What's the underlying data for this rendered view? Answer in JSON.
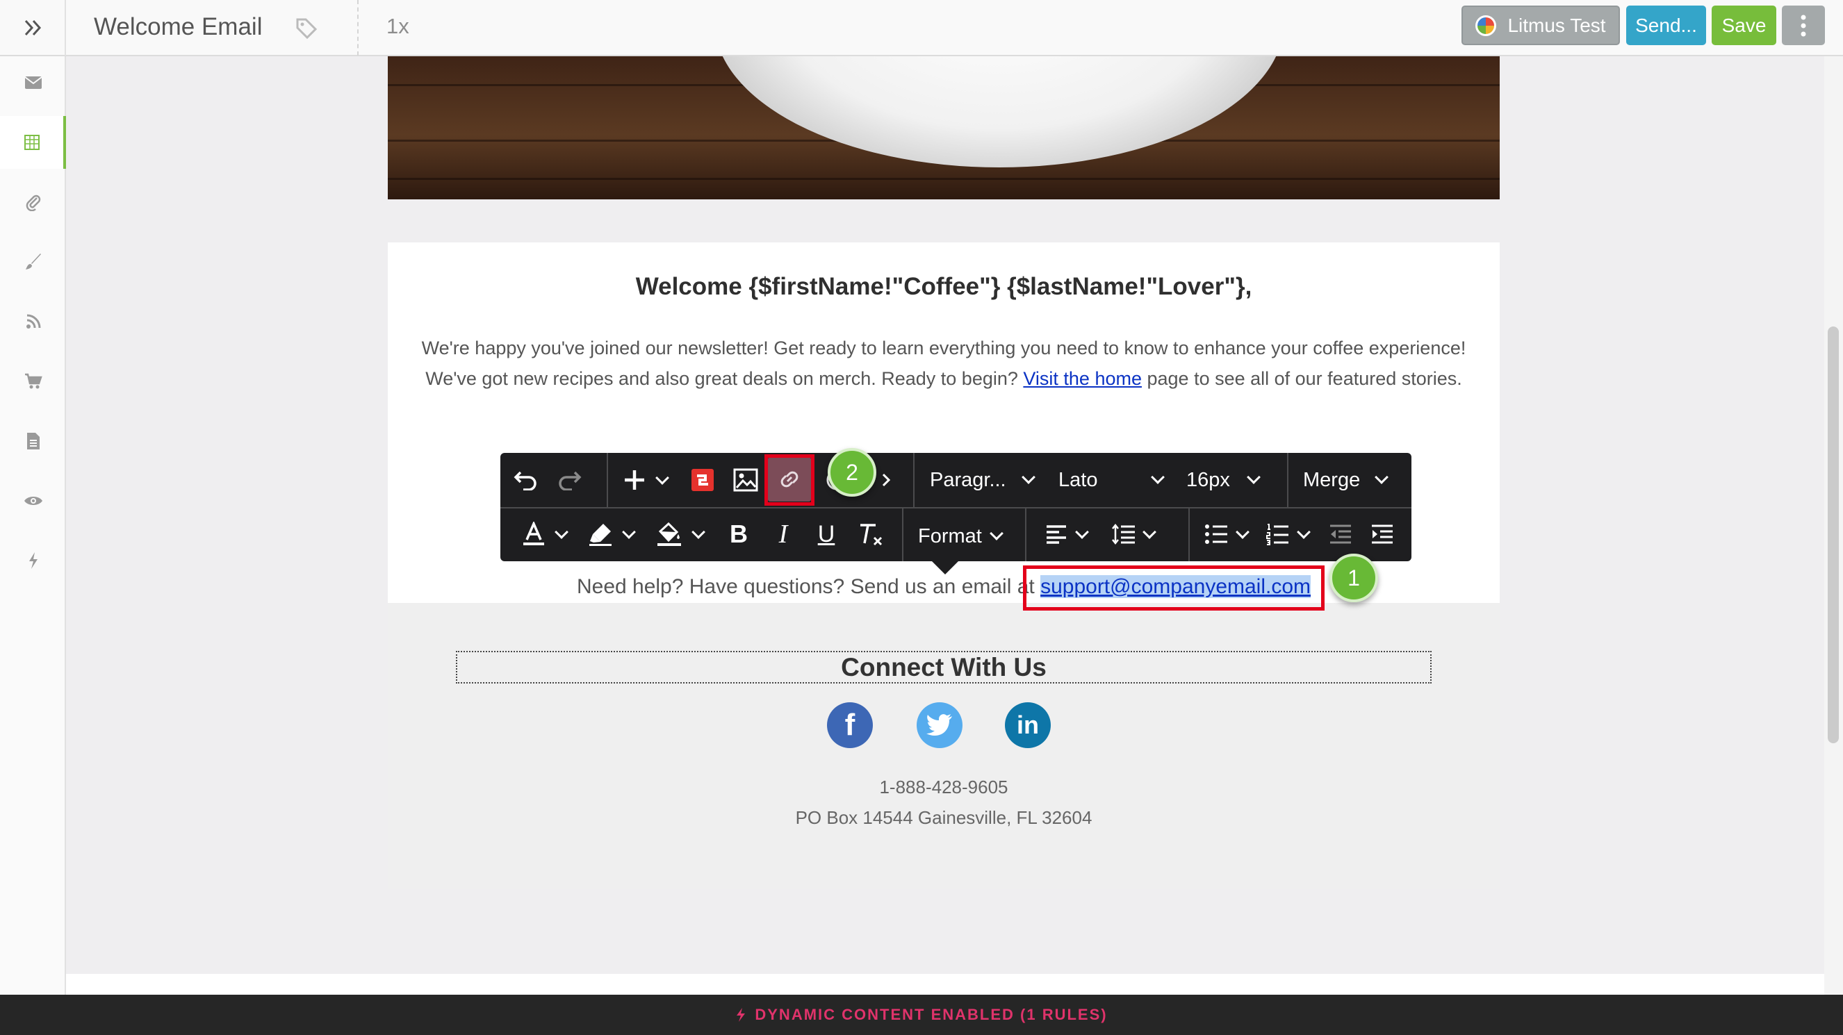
{
  "header": {
    "title": "Welcome Email",
    "zoom": "1x",
    "litmus_label": "Litmus Test",
    "send_label": "Send...",
    "save_label": "Save"
  },
  "sidebar": {
    "items": [
      {
        "icon": "envelope-icon"
      },
      {
        "icon": "layout-grid-icon",
        "active": true
      },
      {
        "icon": "paperclip-icon"
      },
      {
        "icon": "paintbrush-icon"
      },
      {
        "icon": "rss-icon"
      },
      {
        "icon": "cart-icon"
      },
      {
        "icon": "document-icon"
      },
      {
        "icon": "eye-icon"
      },
      {
        "icon": "lightning-icon"
      }
    ]
  },
  "email": {
    "greeting": "Welcome {$firstName!\"Coffee\"} {$lastName!\"Lover\"},",
    "intro_line1": "We're happy you've joined our newsletter! Get ready to learn everything you need to know to enhance your coffee experience!",
    "intro_line2_pre": "We've got new recipes and also great deals on merch. Ready to begin? ",
    "intro_link": "Visit the home",
    "intro_line2_post": " page to see all of our featured stories.",
    "help_text": "Need help? Have questions? Send us an email at ",
    "help_email": "support@companyemail.com",
    "connect_heading": "Connect With Us",
    "phone": "1-888-428-9605",
    "address": "PO Box 14544 Gainesville, FL 32604"
  },
  "toolbar": {
    "paragraph": "Paragr...",
    "font": "Lato",
    "size": "16px",
    "merge": "Merge",
    "format": "Format"
  },
  "steps": {
    "one": "1",
    "two": "2"
  },
  "status_bar": {
    "text": "DYNAMIC CONTENT ENABLED (1 RULES)"
  },
  "colors": {
    "save_green": "#77bd3b",
    "send_blue": "#34a5c9",
    "highlight_red": "#e3001b",
    "step_green": "#68b936",
    "status_pink": "#e0336b"
  }
}
